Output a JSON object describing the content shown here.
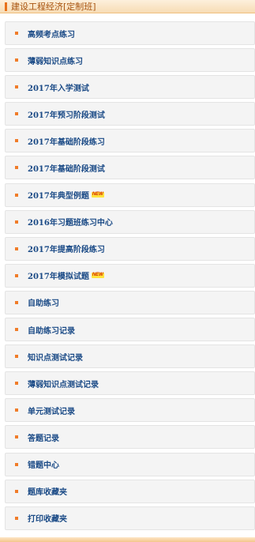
{
  "header": {
    "title": "建设工程经济[定制班]"
  },
  "items": [
    {
      "label": "高频考点练习",
      "badge": ""
    },
    {
      "label": "薄弱知识点练习",
      "badge": ""
    },
    {
      "label": "2017年入学测试",
      "badge": ""
    },
    {
      "label": "2017年预习阶段测试",
      "badge": ""
    },
    {
      "label": "2017年基础阶段练习",
      "badge": ""
    },
    {
      "label": "2017年基础阶段测试",
      "badge": ""
    },
    {
      "label": "2017年典型例题",
      "badge": "NEW"
    },
    {
      "label": "2016年习题班练习中心",
      "badge": ""
    },
    {
      "label": "2017年提高阶段练习",
      "badge": ""
    },
    {
      "label": "2017年模拟试题",
      "badge": "NEW"
    },
    {
      "label": "自助练习",
      "badge": ""
    },
    {
      "label": "自助练习记录",
      "badge": ""
    },
    {
      "label": "知识点测试记录",
      "badge": ""
    },
    {
      "label": "薄弱知识点测试记录",
      "badge": ""
    },
    {
      "label": "单元测试记录",
      "badge": ""
    },
    {
      "label": "答题记录",
      "badge": ""
    },
    {
      "label": "错题中心",
      "badge": ""
    },
    {
      "label": "题库收藏夹",
      "badge": ""
    },
    {
      "label": "打印收藏夹",
      "badge": ""
    }
  ]
}
